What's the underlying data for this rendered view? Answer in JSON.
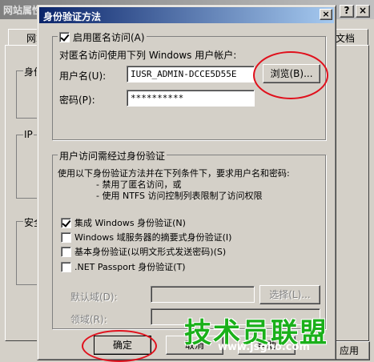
{
  "background_window": {
    "title": "网站属性",
    "tab_left": "网站",
    "tab_right": "文档",
    "group_labels": [
      "身份",
      "IP",
      "安全"
    ],
    "help_button": "?",
    "close_button": "×",
    "apply_button": "应用"
  },
  "dialog": {
    "title": "身份验证方法",
    "close_glyph": "×",
    "anonymous": {
      "checkbox_label": "启用匿名访问(A)",
      "checked": true,
      "description": "对匿名访问使用下列 Windows 用户帐户:",
      "username_label": "用户名(U):",
      "username_value": "IUSR_ADMIN-DCCE5D55E",
      "browse_button": "浏览(B)...",
      "password_label": "密码(P):",
      "password_value": "**********"
    },
    "auth": {
      "legend": "用户访问需经过身份验证",
      "description": "使用以下身份验证方法并在下列条件下，要求用户名和密码:",
      "condition_1": "- 禁用了匿名访问，或",
      "condition_2": "- 使用 NTFS 访问控制列表限制了访问权限",
      "options": [
        {
          "label": "集成 Windows 身份验证(N)",
          "checked": true
        },
        {
          "label": "Windows 域服务器的摘要式身份验证(I)",
          "checked": false
        },
        {
          "label": "基本身份验证(以明文形式发送密码)(S)",
          "checked": false
        },
        {
          "label": ".NET Passport 身份验证(T)",
          "checked": false
        }
      ],
      "default_domain_label": "默认域(D):",
      "default_domain_value": "",
      "select_button": "选择(L)...",
      "realm_label": "领域(R):",
      "realm_value": ""
    },
    "buttons": {
      "ok": "确定",
      "cancel": "取消",
      "help": "帮助"
    }
  },
  "watermark": {
    "text": "技术员联盟",
    "url": "www.jsgho.com"
  },
  "colors": {
    "title_active_start": "#0a246a",
    "title_active_end": "#a6caf0",
    "annotation_red": "#e0101c",
    "watermark_green": "#1ab01a",
    "face": "#d4d0c8"
  }
}
